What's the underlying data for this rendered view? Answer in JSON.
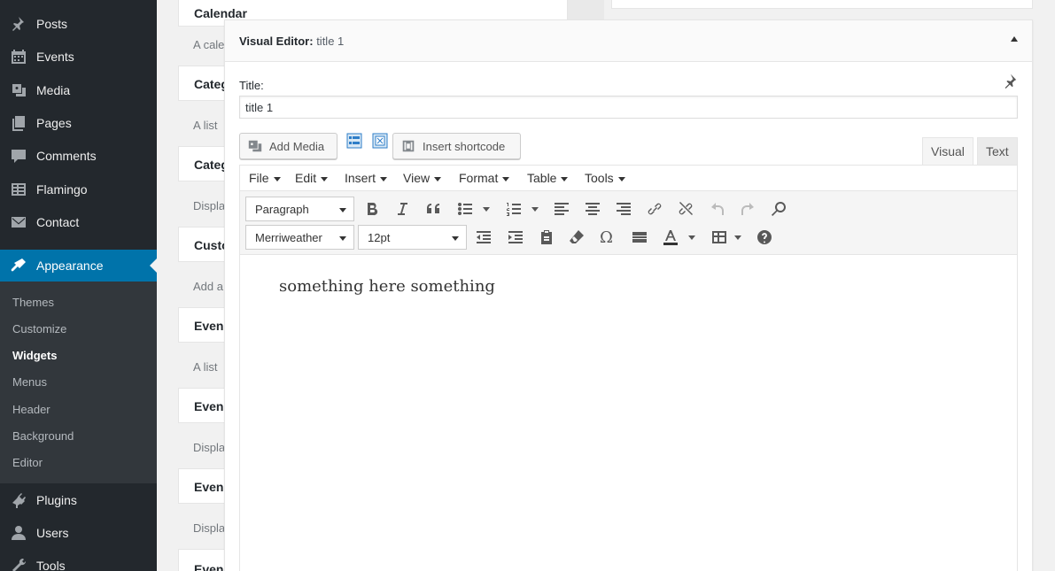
{
  "sidebar": {
    "items": [
      {
        "label": "Posts",
        "icon": "pushpin-icon"
      },
      {
        "label": "Events",
        "icon": "calendar-icon"
      },
      {
        "label": "Media",
        "icon": "media-icon"
      },
      {
        "label": "Pages",
        "icon": "pages-icon"
      },
      {
        "label": "Comments",
        "icon": "comments-icon"
      },
      {
        "label": "Flamingo",
        "icon": "flamingo-icon"
      },
      {
        "label": "Contact",
        "icon": "mail-icon"
      },
      {
        "label": "Appearance",
        "icon": "brush-icon",
        "current": true
      },
      {
        "label": "Plugins",
        "icon": "plugin-icon"
      },
      {
        "label": "Users",
        "icon": "users-icon"
      },
      {
        "label": "Tools",
        "icon": "tools-icon"
      }
    ],
    "submenu": [
      "Themes",
      "Customize",
      "Widgets",
      "Menus",
      "Header",
      "Background",
      "Editor"
    ],
    "submenu_current": "Widgets"
  },
  "widgets": [
    {
      "title": "Calendar",
      "desc": "A cale"
    },
    {
      "title": "Categ",
      "desc": "A list"
    },
    {
      "title": "Categ",
      "desc": "Displa"
    },
    {
      "title": "Custo",
      "desc": "Add a"
    },
    {
      "title": "Even",
      "desc": "A list"
    },
    {
      "title": "Even",
      "desc": "Displa"
    },
    {
      "title": "Even",
      "desc": "Displa"
    },
    {
      "title": "Even",
      "desc": ""
    }
  ],
  "modal": {
    "header_title": "Visual Editor:",
    "header_name": "title 1",
    "title_label": "Title:",
    "title_value": "title 1",
    "add_media_label": "Add Media",
    "insert_shortcode_label": "Insert shortcode",
    "tabs": {
      "visual": "Visual",
      "text": "Text"
    },
    "menubar": [
      "File",
      "Edit",
      "Insert",
      "View",
      "Format",
      "Table",
      "Tools"
    ],
    "format_select": "Paragraph",
    "font_select": "Merriweather",
    "size_select": "12pt",
    "content": "something here something"
  },
  "colors": {
    "sidebar_bg": "#23282d",
    "accent": "#0073aa",
    "submenu_bg": "#32373c"
  }
}
